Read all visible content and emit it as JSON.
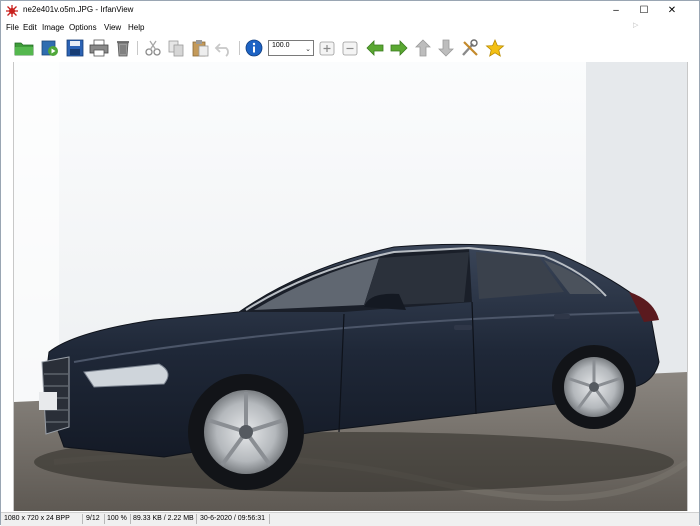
{
  "window": {
    "title": "ne2e401v.o5m.JPG - IrfanView",
    "minimize_glyph": "–",
    "maximize_glyph": "☐",
    "close_glyph": "✕",
    "resize_hint": "▷"
  },
  "menu": {
    "items": [
      {
        "label": "File"
      },
      {
        "label": "Edit"
      },
      {
        "label": "Image"
      },
      {
        "label": "Options"
      },
      {
        "label": "View"
      },
      {
        "label": "Help"
      }
    ]
  },
  "toolbar": {
    "buttons": [
      {
        "icon": "open-folder-icon"
      },
      {
        "icon": "slideshow-icon"
      },
      {
        "icon": "save-icon"
      },
      {
        "icon": "print-icon"
      },
      {
        "icon": "delete-icon"
      },
      {
        "icon": "cut-icon"
      },
      {
        "icon": "copy-icon"
      },
      {
        "icon": "paste-icon"
      },
      {
        "icon": "undo-icon"
      },
      {
        "icon": "info-icon"
      },
      {
        "icon": "zoom-in-icon"
      },
      {
        "icon": "zoom-out-icon"
      },
      {
        "icon": "previous-arrow-icon"
      },
      {
        "icon": "next-arrow-icon"
      },
      {
        "icon": "first-arrow-icon"
      },
      {
        "icon": "last-arrow-icon"
      },
      {
        "icon": "settings-tools-icon"
      },
      {
        "icon": "favorite-star-icon"
      }
    ],
    "zoom_value": "100.0",
    "zoom_arrow": "⌄"
  },
  "colors": {
    "car_body": "#1f2838",
    "wall": "#f4f6f8",
    "floor": "#6f6a63",
    "arrow_green": "#5aa832",
    "info_blue": "#1d63c4",
    "star_yellow": "#f3c014"
  },
  "status": {
    "dimensions": "1080 x 720 x 24 BPP",
    "index": "9/12",
    "zoom": "100 %",
    "size": "89.33 KB / 2.22 MB",
    "datetime": "30-6-2020 / 09:56:31"
  }
}
